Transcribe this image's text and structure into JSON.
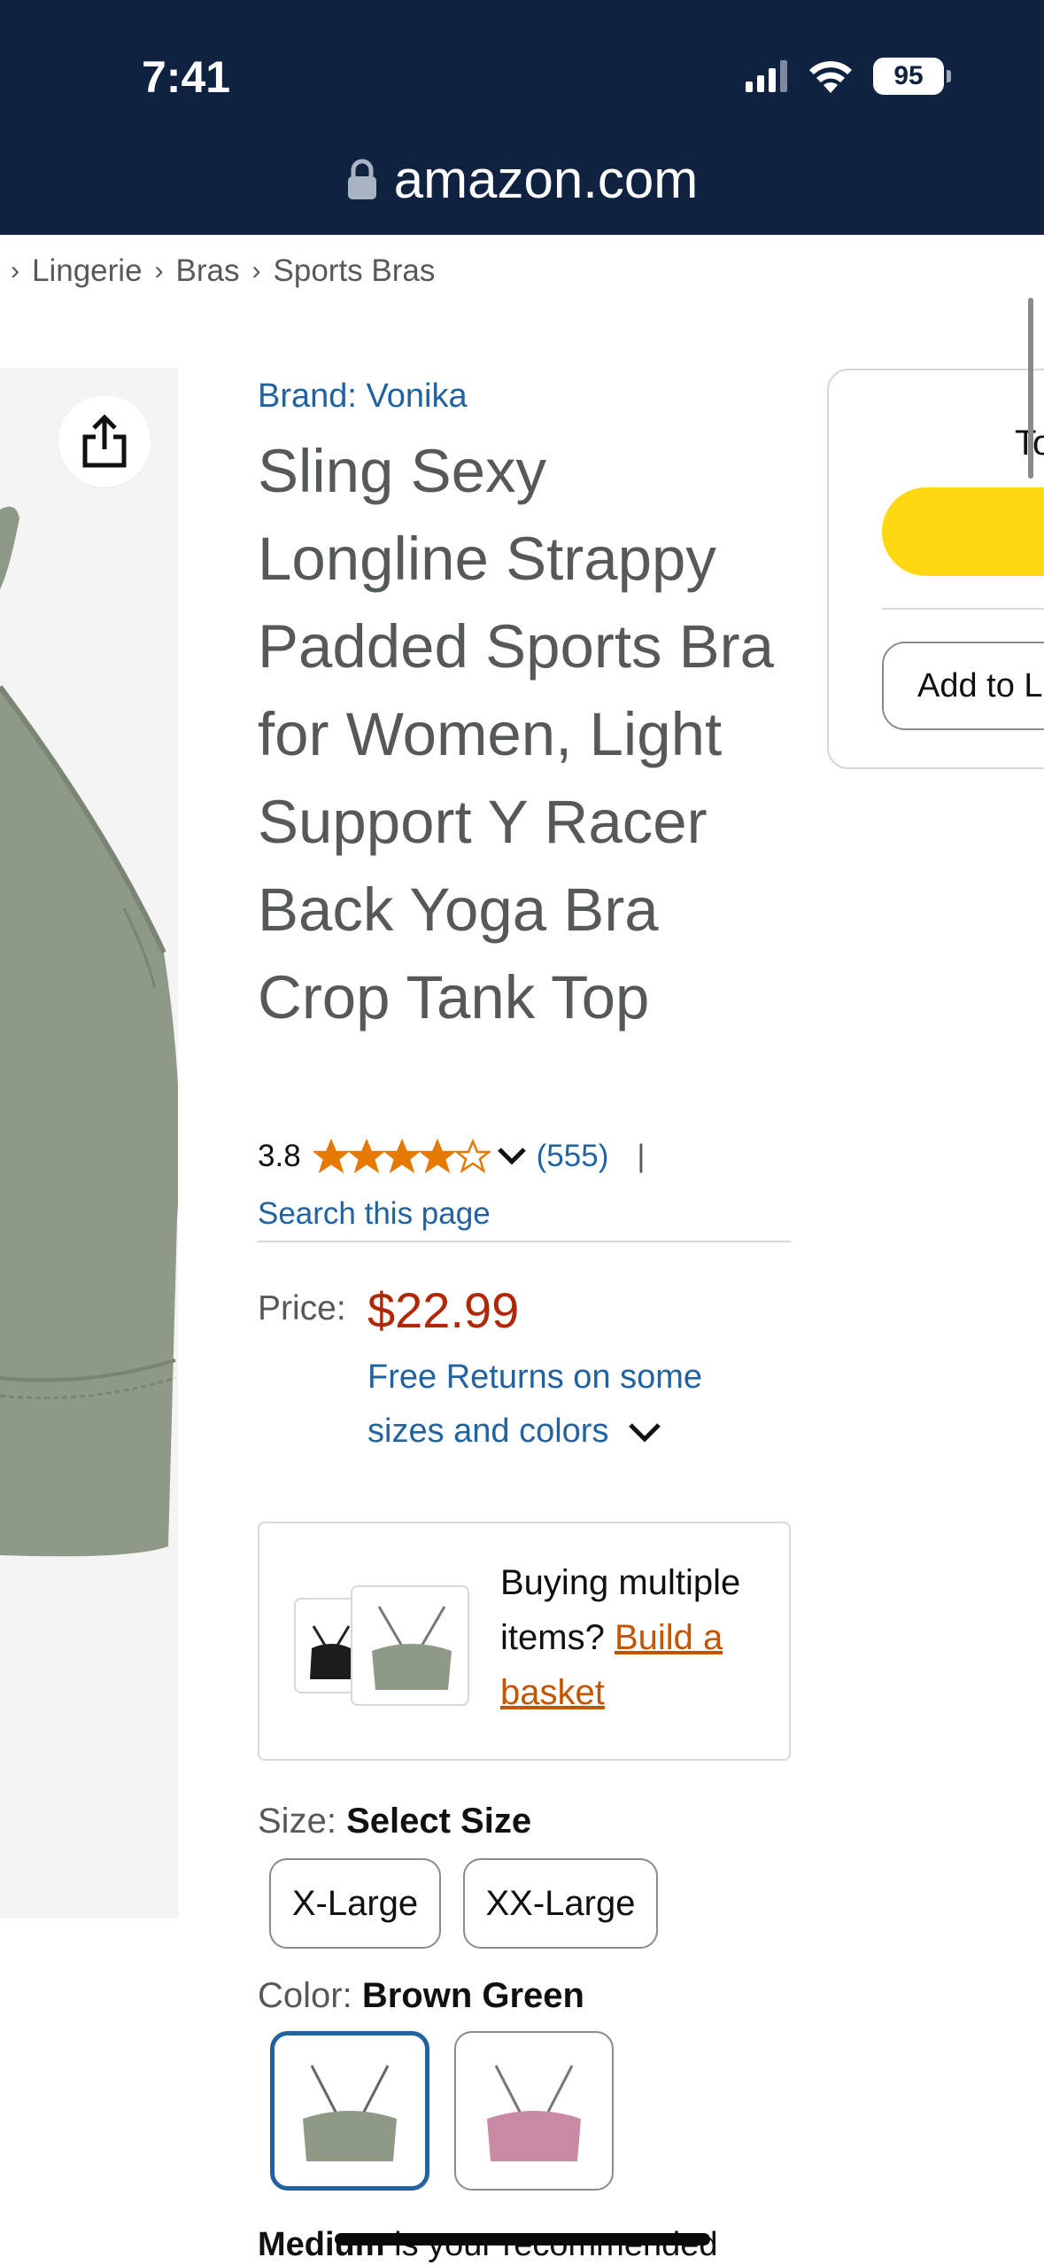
{
  "status_bar": {
    "time": "7:41",
    "battery": "95"
  },
  "url_bar": {
    "domain": "amazon.com"
  },
  "breadcrumb": [
    "Lingerie",
    "Bras",
    "Sports Bras"
  ],
  "buy_box": {
    "partial_text": "To",
    "add_to_list_label": "Add to List"
  },
  "product": {
    "brand": "Brand: Vonika",
    "title": "Sling Sexy Longline Strappy Padded Sports Bra for Women, Light Support Y Racer Back Yoga Bra Crop Tank Top",
    "rating_value": "3.8",
    "rating_stars": 3.8,
    "rating_count": "(555)",
    "rating_separator": "|",
    "search_page_label": "Search this page"
  },
  "price": {
    "label": "Price:",
    "value": "$22.99",
    "returns_text": "Free Returns on some sizes and colors"
  },
  "multi_buy": {
    "text": "Buying multiple items?",
    "link": "Build a basket"
  },
  "size": {
    "label": "Size:",
    "selected": "Select Size",
    "options": [
      "X-Large",
      "XX-Large"
    ]
  },
  "color": {
    "label": "Color:",
    "selected": "Brown Green",
    "swatch_colors": [
      "#8f9a86",
      "#c98aa6"
    ]
  },
  "recommend": {
    "bold": "Medium",
    "text": "is your recommended"
  },
  "colors": {
    "topbar": "#0f2341",
    "link": "#2162a1",
    "price": "#b12704",
    "star": "#e67a00",
    "cart": "#ffd814"
  },
  "icons": {
    "lock": "lock-icon",
    "share": "share-icon",
    "chevron": "chevron-down-icon"
  }
}
